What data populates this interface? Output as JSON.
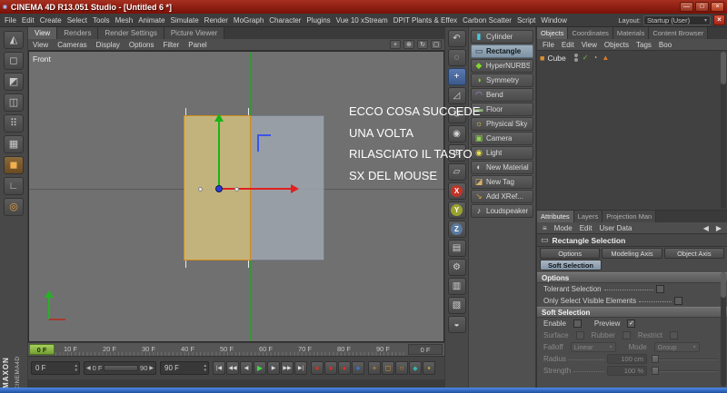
{
  "window": {
    "title": "CINEMA 4D R13.051 Studio - [Untitled 6 *]"
  },
  "menubar": {
    "items": [
      "File",
      "Edit",
      "Create",
      "Select",
      "Tools",
      "Mesh",
      "Animate",
      "Simulate",
      "Render",
      "MoGraph",
      "Character",
      "Plugins",
      "Vue 10 xStream",
      "DPIT Plants & Effex",
      "Carbon Scatter",
      "Script",
      "Window"
    ],
    "layout_label": "Layout:",
    "layout_value": "Startup (User)"
  },
  "view_tabs": [
    "View",
    "Renders",
    "Render Settings",
    "Picture Viewer"
  ],
  "viewport": {
    "menu": [
      "View",
      "Cameras",
      "Display",
      "Options",
      "Filter",
      "Panel"
    ],
    "label": "Front",
    "annotation": [
      "ECCO COSA SUCCEDE",
      "UNA VOLTA",
      "RILASCIATO IL TASTO",
      "SX DEL MOUSE"
    ]
  },
  "palette": {
    "items": [
      {
        "label": "Cylinder",
        "glyph": "▮"
      },
      {
        "label": "Rectangle",
        "glyph": "▭"
      },
      {
        "label": "HyperNURBS",
        "glyph": "◆"
      },
      {
        "label": "Symmetry",
        "glyph": "◑"
      },
      {
        "label": "Bend",
        "glyph": "◠"
      },
      {
        "label": "Floor",
        "glyph": "▬"
      },
      {
        "label": "Physical Sky",
        "glyph": "☼"
      },
      {
        "label": "Camera",
        "glyph": "▣"
      },
      {
        "label": "Light",
        "glyph": "◉"
      },
      {
        "label": "New Material",
        "glyph": "◐"
      },
      {
        "label": "New Tag",
        "glyph": "◪"
      },
      {
        "label": "Add XRef...",
        "glyph": "↘"
      },
      {
        "label": "Loudspeaker",
        "glyph": "♪"
      }
    ]
  },
  "object_manager": {
    "tabs": [
      "Objects",
      "Coordinates",
      "Materials",
      "Content Browser"
    ],
    "menu": [
      "File",
      "Edit",
      "View",
      "Objects",
      "Tags",
      "Boo"
    ],
    "object_name": "Cube"
  },
  "attributes": {
    "tabs": [
      "Attributes",
      "Layers",
      "Projection Man"
    ],
    "menu": [
      "Mode",
      "Edit",
      "User Data"
    ],
    "title": "Rectangle Selection",
    "buttons": [
      "Options",
      "Modeling Axis",
      "Object Axis"
    ],
    "soft_button": "Soft Selection",
    "options_header": "Options",
    "rows": {
      "tolerant": "Tolerant Selection",
      "only_visible": "Only Select Visible Elements"
    },
    "soft_header": "Soft Selection",
    "enable": "Enable",
    "preview": "Preview",
    "surface": "Surface",
    "rubber": "Rubber",
    "restrict": "Restrict",
    "falloff": "Falloff",
    "falloff_value": "Linear",
    "mode": "Mode",
    "mode_value": "Group",
    "radius": "Radius",
    "radius_value": "100 cm",
    "strength": "Strength",
    "strength_value": "100 %"
  },
  "timeline": {
    "current": "0 F",
    "ticks": [
      "10 F",
      "20 F",
      "30 F",
      "40 F",
      "50 F",
      "60 F",
      "70 F",
      "80 F",
      "90 F"
    ],
    "end_label": "0 F"
  },
  "transport": {
    "start_value": "0 F",
    "range_start": "0 F",
    "range_end": "90",
    "end_value": "90 F",
    "go_start": "|◀",
    "prev_key": "◀◀",
    "prev_frame": "◀",
    "play": "▶",
    "next_frame": "▶",
    "next_key": "▶▶",
    "go_end": "▶|",
    "record_glyph": "●",
    "key_position": "+",
    "key_scale": "◻",
    "key_rotation": "○",
    "key_parameter": "◆",
    "key_pla": "▪"
  },
  "icons": {
    "app": "■",
    "minimize": "—",
    "maximize": "□",
    "close": "×",
    "doc_close": "×",
    "arrow": "▾",
    "spin_up": "▴",
    "spin_down": "▾",
    "make_editable": "◭",
    "model_mode": "◻",
    "texture_mode": "◩",
    "workplane_mode": "◫",
    "points_mode": "⠿",
    "edges_mode": "▦",
    "polygons_mode": "◼",
    "axis_mode": "∟",
    "snap": "◎",
    "undo": "↶",
    "live_selection": "◌",
    "move_tool": "+",
    "scale_tool": "◿",
    "rotate_tool": "↻",
    "last_tool": "◉",
    "coord_system": "⊕",
    "workplane": "▱",
    "x_lock": "X",
    "y_lock": "Y",
    "z_lock": "Z",
    "render_view": "▤",
    "render_settings": "⚙",
    "ir_region": "▥",
    "display_mode": "▧",
    "material_manager": "◒",
    "pan_view": "+",
    "zoom_view": "⊕",
    "rotate_view": "↻",
    "toggle_view": "▢",
    "menu_grid": "≡",
    "back": "◀",
    "forward": "▶",
    "cube": "■",
    "check": "✓",
    "phong_tag": "◔",
    "selection_tag": "▲",
    "rect_select": "▭"
  },
  "branding": {
    "maxon": "MAXON",
    "cinema": "CINEMA4D"
  },
  "colors": {
    "titlebar_red": "#8c1208",
    "accent_green": "#7fb335",
    "selection_tan": "#c6b67c",
    "selection_border": "#d08a1a",
    "axis_green": "#17b517",
    "axis_red": "#e02020",
    "origin_blue": "#2b3fd6",
    "taskbar_blue": "#2e6dd8"
  }
}
